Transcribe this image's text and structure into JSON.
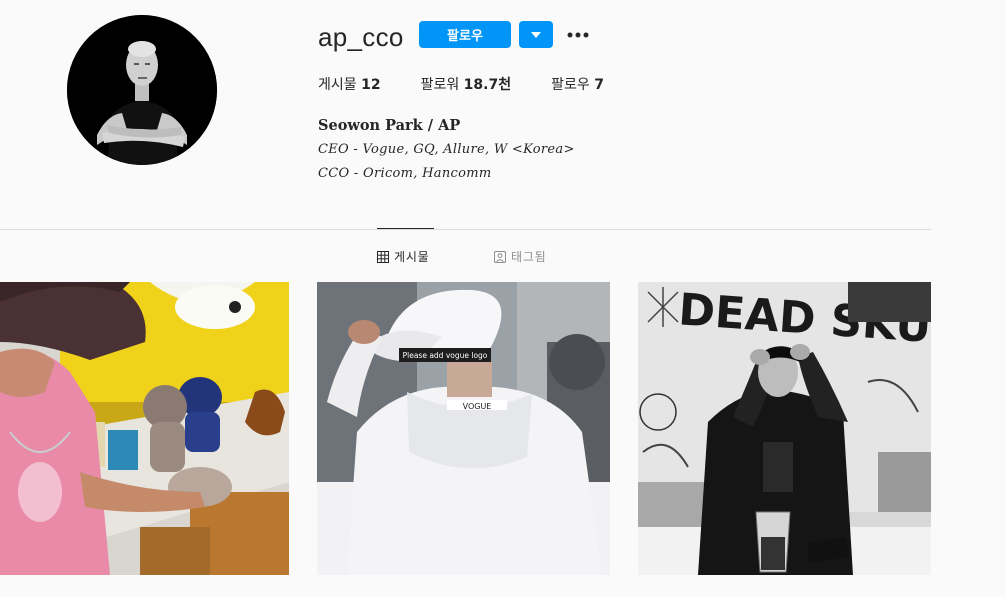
{
  "profile": {
    "username": "ap_cco",
    "follow_label": "팔로우",
    "stats": [
      {
        "label": "게시물",
        "value": "12"
      },
      {
        "label": "팔로워",
        "value": "18.7천"
      },
      {
        "label": "팔로우",
        "value": "7"
      }
    ],
    "full_name": "Seowon Park / AP",
    "bio_lines": [
      "CEO - Vogue, GQ, Allure, W <Korea>",
      "CCO - Oricom, Hancomm"
    ]
  },
  "tabs": [
    {
      "label": "게시물",
      "icon": "grid-icon",
      "active": true
    },
    {
      "label": "태그됨",
      "icon": "tagged-user-icon",
      "active": false
    }
  ],
  "posts": [
    {
      "icon": "photo-kaws-figures"
    },
    {
      "icon": "photo-white-hoodie-cap",
      "cap_text": "Please add vogue logo",
      "hood_text": "VOGUE"
    },
    {
      "icon": "photo-bw-graffiti-wall",
      "wall_text": "DEAD SKULL"
    }
  ],
  "colors": {
    "accent": "#0095f6",
    "text": "#262626",
    "muted": "#8e8e8e",
    "background": "#fafafa",
    "divider": "#dbdbdb"
  }
}
